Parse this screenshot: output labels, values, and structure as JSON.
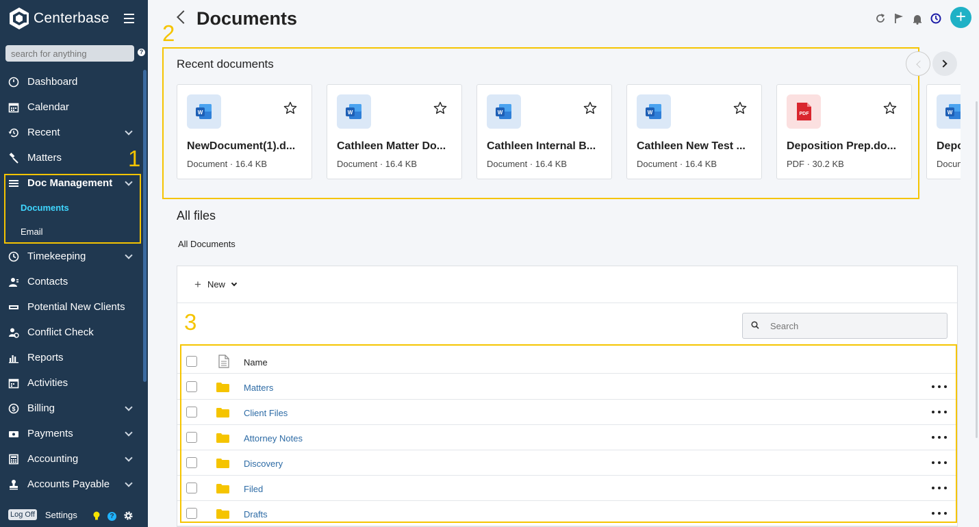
{
  "brand": {
    "name": "Centerbase"
  },
  "sidebar": {
    "search_placeholder": "search for anything",
    "help": "?",
    "items": [
      {
        "label": "Dashboard",
        "icon": "dashboard-icon"
      },
      {
        "label": "Calendar",
        "icon": "calendar-icon"
      },
      {
        "label": "Recent",
        "icon": "history-icon",
        "expandable": true
      },
      {
        "label": "Matters",
        "icon": "gavel-icon"
      },
      {
        "label": "Doc Management",
        "icon": "menu-lines-icon",
        "expandable": true,
        "expanded": true,
        "children": [
          {
            "label": "Documents",
            "active": true
          },
          {
            "label": "Email"
          }
        ]
      },
      {
        "label": "Timekeeping",
        "icon": "clock-icon",
        "expandable": true
      },
      {
        "label": "Contacts",
        "icon": "contacts-icon"
      },
      {
        "label": "Potential New Clients",
        "icon": "ticket-icon"
      },
      {
        "label": "Conflict Check",
        "icon": "conflict-check-icon"
      },
      {
        "label": "Reports",
        "icon": "bar-chart-icon"
      },
      {
        "label": "Activities",
        "icon": "activities-icon"
      },
      {
        "label": "Billing",
        "icon": "dollar-icon",
        "expandable": true
      },
      {
        "label": "Payments",
        "icon": "payments-icon",
        "expandable": true
      },
      {
        "label": "Accounting",
        "icon": "calculator-icon",
        "expandable": true
      },
      {
        "label": "Accounts Payable",
        "icon": "stamp-icon",
        "expandable": true
      }
    ],
    "footer": {
      "logoff": "Log Off",
      "settings": "Settings",
      "help": "?"
    }
  },
  "header": {
    "title": "Documents"
  },
  "annotations": {
    "one": "1",
    "two": "2",
    "three": "3",
    "color": "#f5c400"
  },
  "recent": {
    "title": "Recent documents",
    "cards": [
      {
        "name": "NewDocument(1).d...",
        "meta": "Document · 16.4 KB",
        "type": "word"
      },
      {
        "name": "Cathleen Matter Do...",
        "meta": "Document · 16.4 KB",
        "type": "word"
      },
      {
        "name": "Cathleen Internal B...",
        "meta": "Document · 16.4 KB",
        "type": "word"
      },
      {
        "name": "Cathleen New Test ...",
        "meta": "Document · 16.4 KB",
        "type": "word"
      },
      {
        "name": "Deposition Prep.do...",
        "meta": "PDF · 30.2 KB",
        "type": "pdf"
      },
      {
        "name": "Depo",
        "meta": "Docum",
        "type": "word"
      }
    ]
  },
  "files": {
    "title": "All files",
    "breadcrumb": "All Documents",
    "new_label": "New",
    "search_placeholder": "Search",
    "column_name": "Name",
    "rows": [
      "Matters",
      "Client Files",
      "Attorney Notes",
      "Discovery",
      "Filed",
      "Drafts"
    ]
  },
  "colors": {
    "sidebar": "#203850",
    "accent": "#1fb1c6",
    "active_sub": "#3fd6ff",
    "folder": "#f5c400",
    "link": "#2d6ba5"
  }
}
